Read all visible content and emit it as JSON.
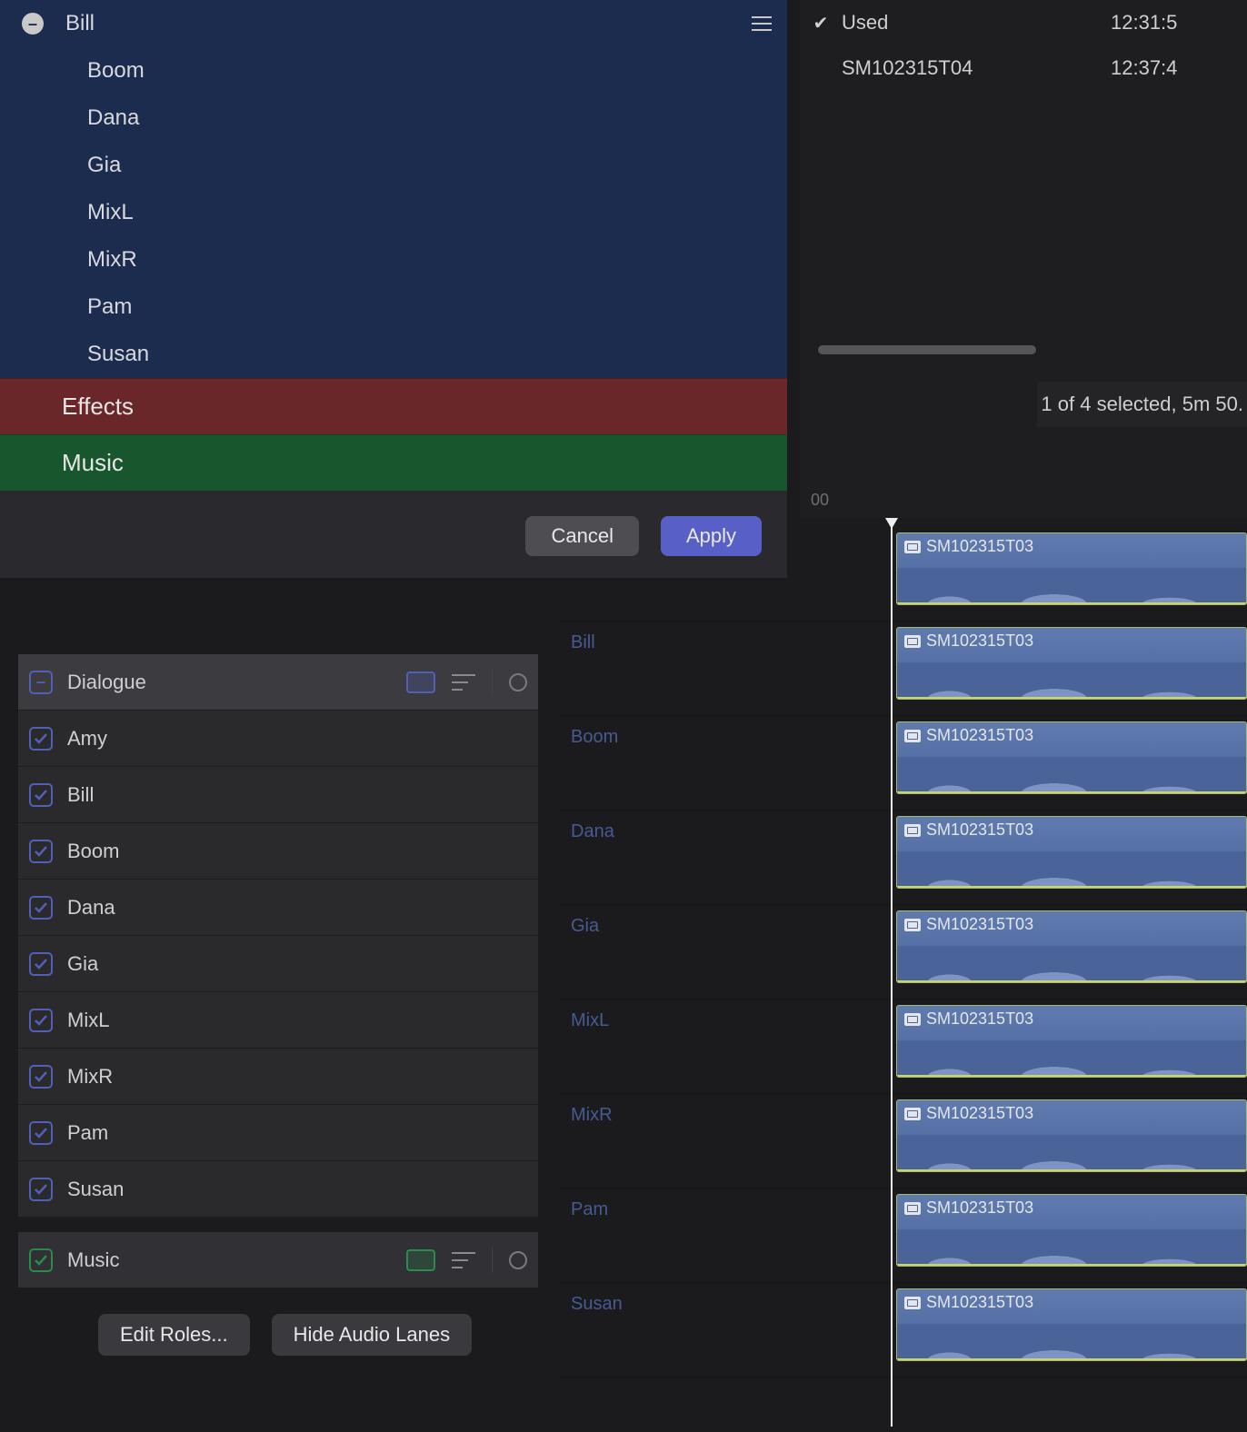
{
  "dialog": {
    "subroles": [
      "Bill",
      "Boom",
      "Dana",
      "Gia",
      "MixL",
      "MixR",
      "Pam",
      "Susan"
    ],
    "effects_label": "Effects",
    "music_label": "Music",
    "cancel_label": "Cancel",
    "apply_label": "Apply"
  },
  "browser": {
    "rows": [
      {
        "checked": true,
        "name": "Used",
        "ts": "12:31:5"
      },
      {
        "checked": false,
        "name": "SM102315T04",
        "ts": "12:37:4"
      }
    ],
    "selection_info": "1 of 4 selected, 5m 50.",
    "ruler_tick": "00"
  },
  "index": {
    "dialogue_label": "Dialogue",
    "subroles": [
      "Amy",
      "Bill",
      "Boom",
      "Dana",
      "Gia",
      "MixL",
      "MixR",
      "Pam",
      "Susan"
    ],
    "music_label": "Music",
    "edit_roles_label": "Edit Roles...",
    "hide_lanes_label": "Hide Audio Lanes"
  },
  "timeline": {
    "clip_name": "SM102315T03",
    "lanes": [
      "",
      "Bill",
      "Boom",
      "Dana",
      "Gia",
      "MixL",
      "MixR",
      "Pam",
      "Susan"
    ]
  }
}
